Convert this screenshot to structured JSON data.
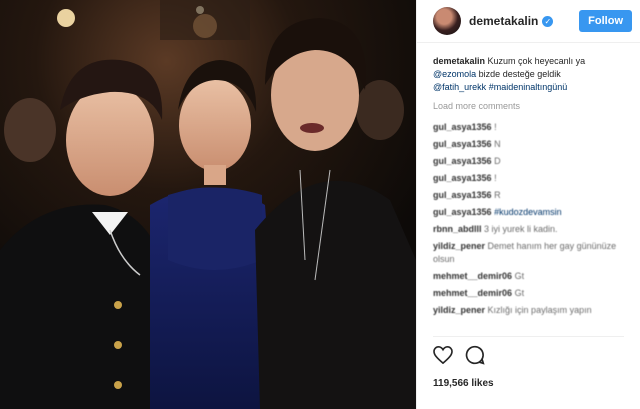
{
  "header": {
    "username": "demetakalin",
    "follow_label": "Follow"
  },
  "caption": {
    "username": "demetakalin",
    "text": "Kuzum çok heyecanlı ya",
    "mention1": "@ezomola",
    "text2": "bizde desteğe geldik",
    "mention2": "@fatih_urekk",
    "hashtag": "#maideninaltıngünü"
  },
  "load_more": "Load more comments",
  "comments": [
    {
      "user": "gul_asya1356",
      "text": "!"
    },
    {
      "user": "gul_asya1356",
      "text": "N"
    },
    {
      "user": "gul_asya1356",
      "text": "D"
    },
    {
      "user": "gul_asya1356",
      "text": "!"
    },
    {
      "user": "gul_asya1356",
      "text": "R"
    },
    {
      "user": "gul_asya1356",
      "text": "#kudozdevamsin"
    },
    {
      "user": "rbnn_abdlll",
      "text": "3 iyi yurek li kadin."
    },
    {
      "user": "yildiz_pener",
      "text": "Demet hanım her gay gününüze olsun"
    },
    {
      "user": "mehmet__demir06",
      "text": "Gt"
    },
    {
      "user": "mehmet__demir06",
      "text": "Gt"
    },
    {
      "user": "yildiz_pener",
      "text": "Kızlığı için paylaşım yapın"
    }
  ],
  "likes": "119,566 likes",
  "colors": {
    "accent": "#3897f0",
    "link": "#003569"
  },
  "icons": [
    "heart-icon",
    "comment-icon",
    "verified-icon"
  ]
}
